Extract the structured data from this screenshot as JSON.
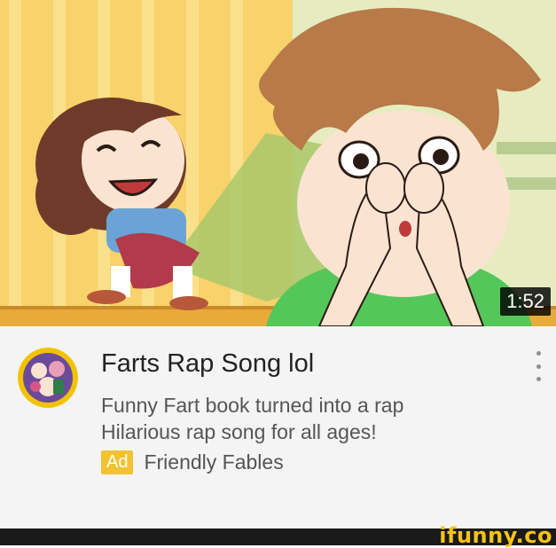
{
  "video": {
    "duration": "1:52",
    "title": "Farts Rap Song lol",
    "description_lines": [
      "Funny Fart book turned into a rap",
      "Hilarious rap song for all ages!"
    ],
    "ad_label": "Ad",
    "channel": "Friendly Fables"
  },
  "icons": {
    "menu": "more-vert-icon",
    "avatar": "channel-avatar"
  },
  "colors": {
    "ad_badge": "#f1c232",
    "info_background": "#f4f4f4",
    "watermark": "#f5c318"
  },
  "watermark": "ifunny.co"
}
